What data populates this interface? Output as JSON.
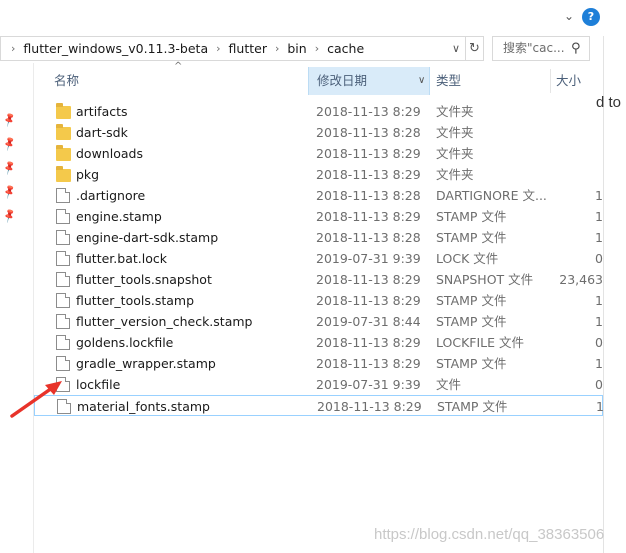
{
  "address": {
    "crumbs": [
      "flutter_windows_v0.11.3-beta",
      "flutter",
      "bin",
      "cache"
    ],
    "separator": "›"
  },
  "search": {
    "placeholder": "搜索\"cac..."
  },
  "columns": {
    "name": "名称",
    "date": "修改日期",
    "type": "类型",
    "size": "大小"
  },
  "background_text": "d to",
  "files": [
    {
      "name": "artifacts",
      "icon": "folder-icon",
      "date": "2018-11-13 8:29",
      "type": "文件夹",
      "size": ""
    },
    {
      "name": "dart-sdk",
      "icon": "folder-icon",
      "date": "2018-11-13 8:28",
      "type": "文件夹",
      "size": ""
    },
    {
      "name": "downloads",
      "icon": "folder-icon",
      "date": "2018-11-13 8:29",
      "type": "文件夹",
      "size": ""
    },
    {
      "name": "pkg",
      "icon": "folder-icon",
      "date": "2018-11-13 8:29",
      "type": "文件夹",
      "size": ""
    },
    {
      "name": ".dartignore",
      "icon": "file-icon",
      "date": "2018-11-13 8:28",
      "type": "DARTIGNORE 文...",
      "size": "1"
    },
    {
      "name": "engine.stamp",
      "icon": "file-icon",
      "date": "2018-11-13 8:29",
      "type": "STAMP 文件",
      "size": "1"
    },
    {
      "name": "engine-dart-sdk.stamp",
      "icon": "file-icon",
      "date": "2018-11-13 8:28",
      "type": "STAMP 文件",
      "size": "1"
    },
    {
      "name": "flutter.bat.lock",
      "icon": "file-icon",
      "date": "2019-07-31 9:39",
      "type": "LOCK 文件",
      "size": "0"
    },
    {
      "name": "flutter_tools.snapshot",
      "icon": "file-icon",
      "date": "2018-11-13 8:29",
      "type": "SNAPSHOT 文件",
      "size": "23,463"
    },
    {
      "name": "flutter_tools.stamp",
      "icon": "file-icon",
      "date": "2018-11-13 8:29",
      "type": "STAMP 文件",
      "size": "1"
    },
    {
      "name": "flutter_version_check.stamp",
      "icon": "file-icon",
      "date": "2019-07-31 8:44",
      "type": "STAMP 文件",
      "size": "1"
    },
    {
      "name": "goldens.lockfile",
      "icon": "file-icon",
      "date": "2018-11-13 8:29",
      "type": "LOCKFILE 文件",
      "size": "0"
    },
    {
      "name": "gradle_wrapper.stamp",
      "icon": "file-icon",
      "date": "2018-11-13 8:29",
      "type": "STAMP 文件",
      "size": "1"
    },
    {
      "name": "lockfile",
      "icon": "file-icon",
      "date": "2019-07-31 9:39",
      "type": "文件",
      "size": "0"
    },
    {
      "name": "material_fonts.stamp",
      "icon": "file-icon",
      "date": "2018-11-13 8:29",
      "type": "STAMP 文件",
      "size": "1"
    }
  ],
  "selected_index": 14,
  "colors": {
    "accent": "#1e7fd8",
    "column_active": "#d9ebf9",
    "selection_border": "#99d1ff",
    "arrow": "#e8332a"
  },
  "watermark": "https://blog.csdn.net/qq_38363506"
}
